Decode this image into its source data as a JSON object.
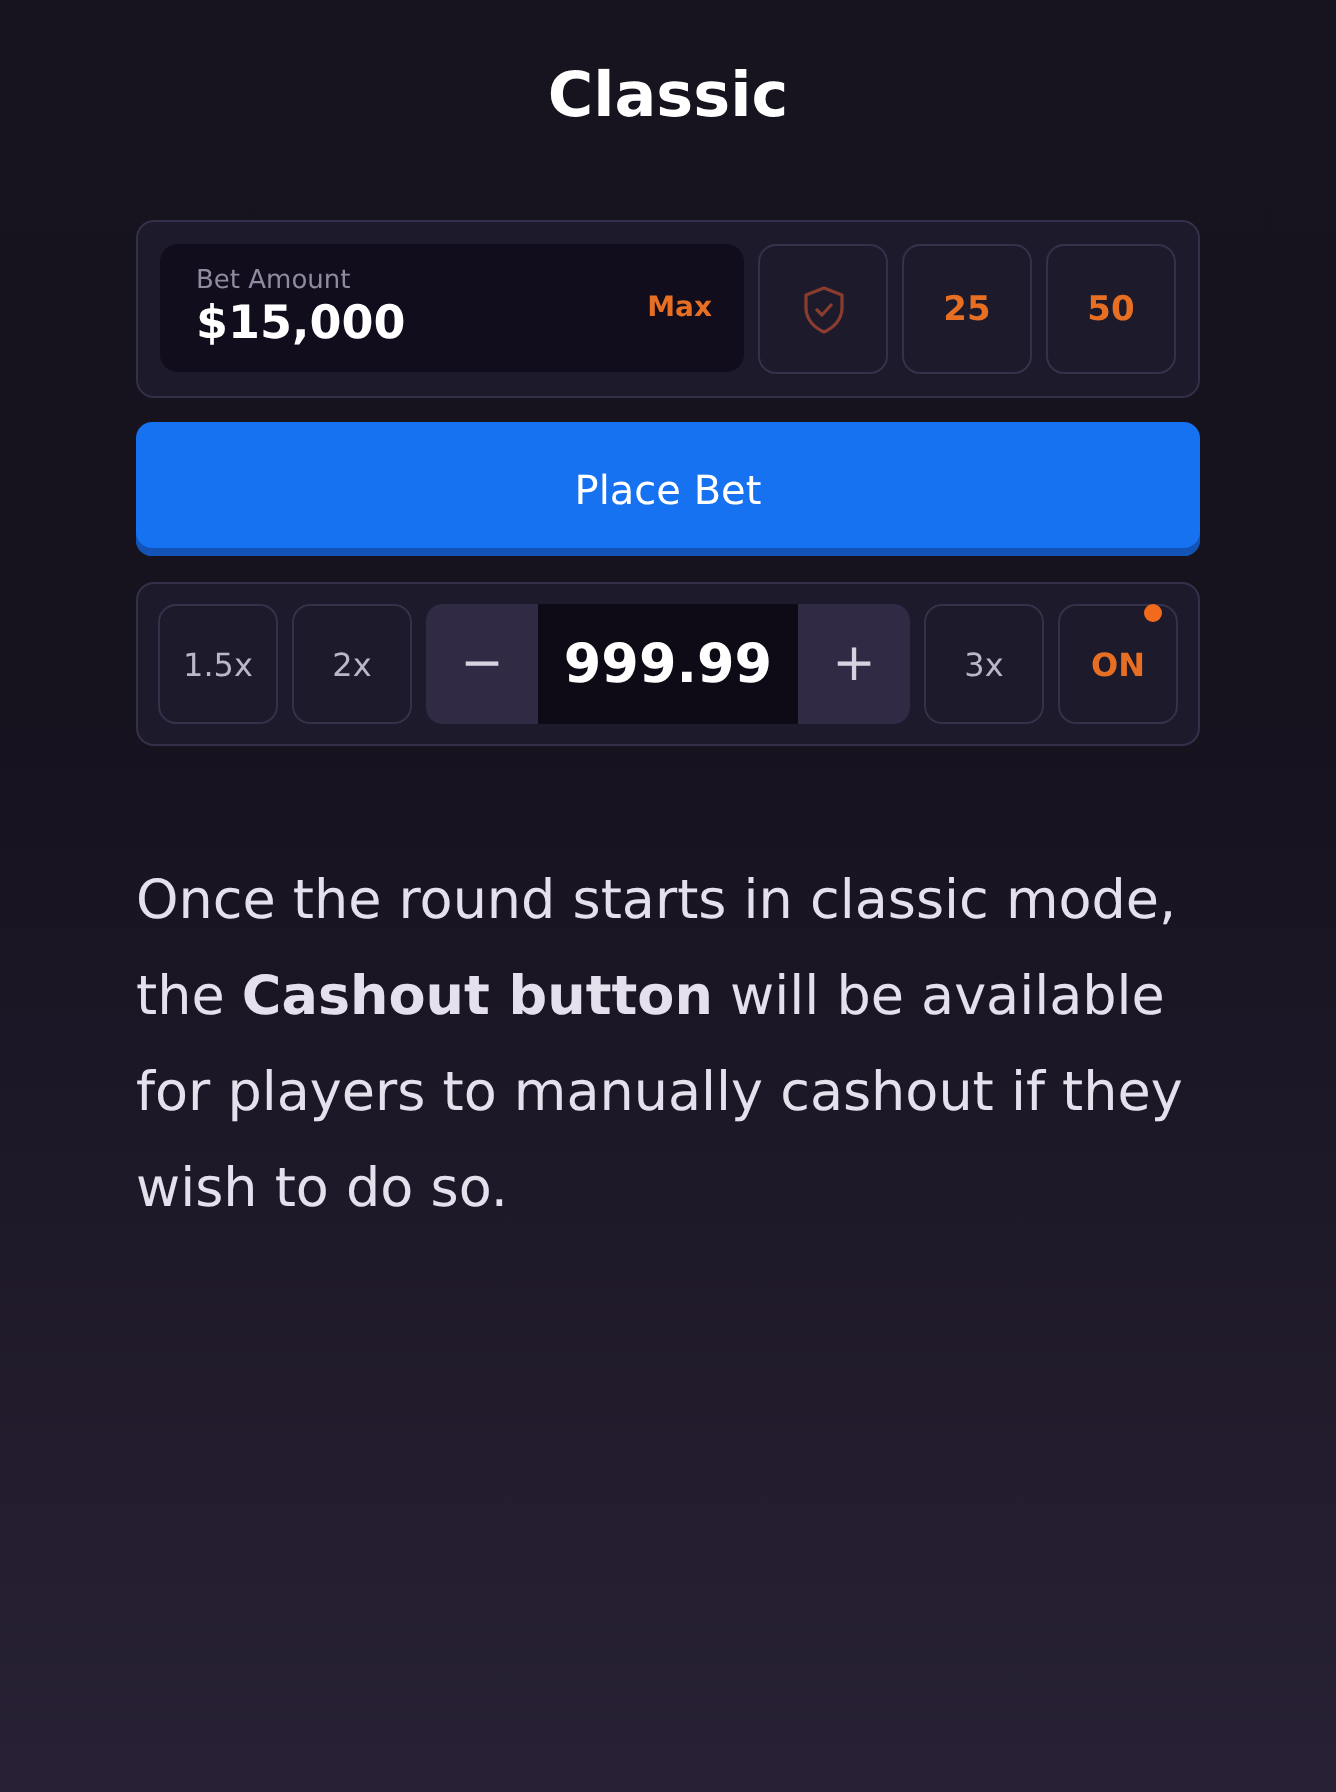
{
  "title": "Classic",
  "bet": {
    "label": "Bet Amount",
    "value": "$15,000",
    "max": "Max",
    "chips": [
      "25",
      "50"
    ]
  },
  "place_button": "Place Bet",
  "multipliers_left": [
    "1.5x",
    "2x"
  ],
  "stepper": {
    "minus": "−",
    "value": "999.99",
    "plus": "+"
  },
  "multipliers_right": [
    "3x"
  ],
  "toggle": {
    "label": "ON",
    "on": true
  },
  "description": "Once the round starts in classic mode, the **Cashout button** will be available for players to manually cashout if they wish to do so."
}
